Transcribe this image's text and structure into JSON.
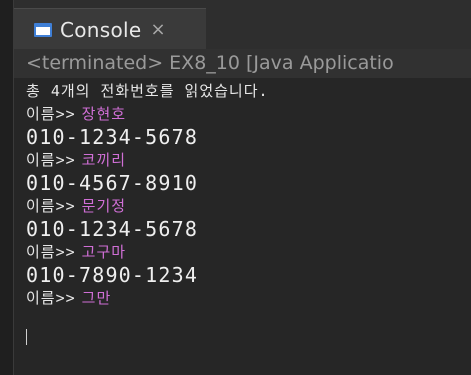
{
  "tab": {
    "icon": "console-icon",
    "label": "Console",
    "close": "×"
  },
  "status": "<terminated> EX8_10 [Java Applicatio",
  "console": {
    "header": "총 4개의 전화번호를 읽었습니다.",
    "prompt": "이름>>",
    "entries": [
      {
        "name": "장현호",
        "phone": "010-1234-5678"
      },
      {
        "name": "코끼리",
        "phone": "010-4567-8910"
      },
      {
        "name": "문기정",
        "phone": "010-1234-5678"
      },
      {
        "name": "고구마",
        "phone": "010-7890-1234"
      }
    ],
    "last_input": "그만"
  },
  "colors": {
    "background": "#262626",
    "input_text": "#d06fd6",
    "output_text": "#efefef",
    "icon_blue": "#3f7fd6"
  }
}
